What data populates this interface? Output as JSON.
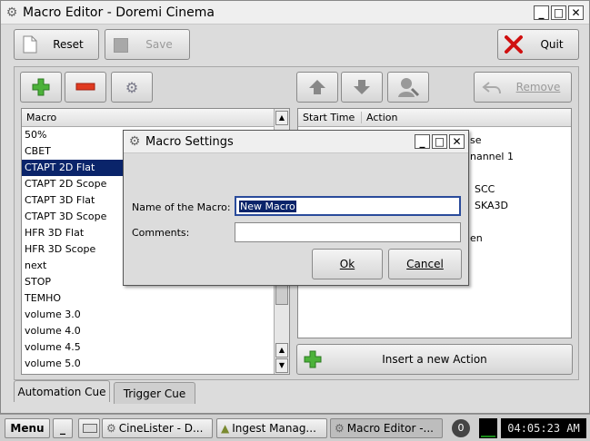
{
  "window": {
    "title": "Macro Editor - Doremi Cinema",
    "controls": {
      "minimize": "_",
      "maximize": "□",
      "close": "✕"
    }
  },
  "toolbar": {
    "reset_label": "Reset",
    "save_label": "Save",
    "quit_label": "Quit"
  },
  "macro_panel": {
    "header": "Macro",
    "items": [
      "50%",
      "CBET",
      "CTAPT 2D Flat",
      "CTAPT 2D Scope",
      "CTAPT 3D Flat",
      "CTAPT 3D Scope",
      "HFR 3D Flat",
      "HFR 3D Scope",
      "next",
      "STOP",
      "TEMHO",
      "volume 3.0",
      "volume 4.0",
      "volume 4.5",
      "volume 5.0"
    ],
    "selected_index": 2
  },
  "action_panel": {
    "header_start_time": "Start Time",
    "header_action": "Action",
    "remove_label": "Remove",
    "insert_label": "Insert a new Action",
    "visible_fragments": [
      "se",
      "nannel 1",
      "SCC",
      "SKA3D",
      "en"
    ]
  },
  "tabs": {
    "automation": "Automation Cue",
    "trigger": "Trigger Cue"
  },
  "dialog": {
    "title": "Macro Settings",
    "name_label": "Name of the Macro:",
    "name_value": "New Macro",
    "comments_label": "Comments:",
    "comments_value": "",
    "ok_label": "Ok",
    "cancel_label": "Cancel"
  },
  "taskbar": {
    "menu_label": "Menu",
    "minimize_label": "_",
    "items": [
      "CineLister - D...",
      "Ingest Manag...",
      "Macro Editor -..."
    ],
    "indicator": "0",
    "clock": "04:05:23 AM"
  }
}
